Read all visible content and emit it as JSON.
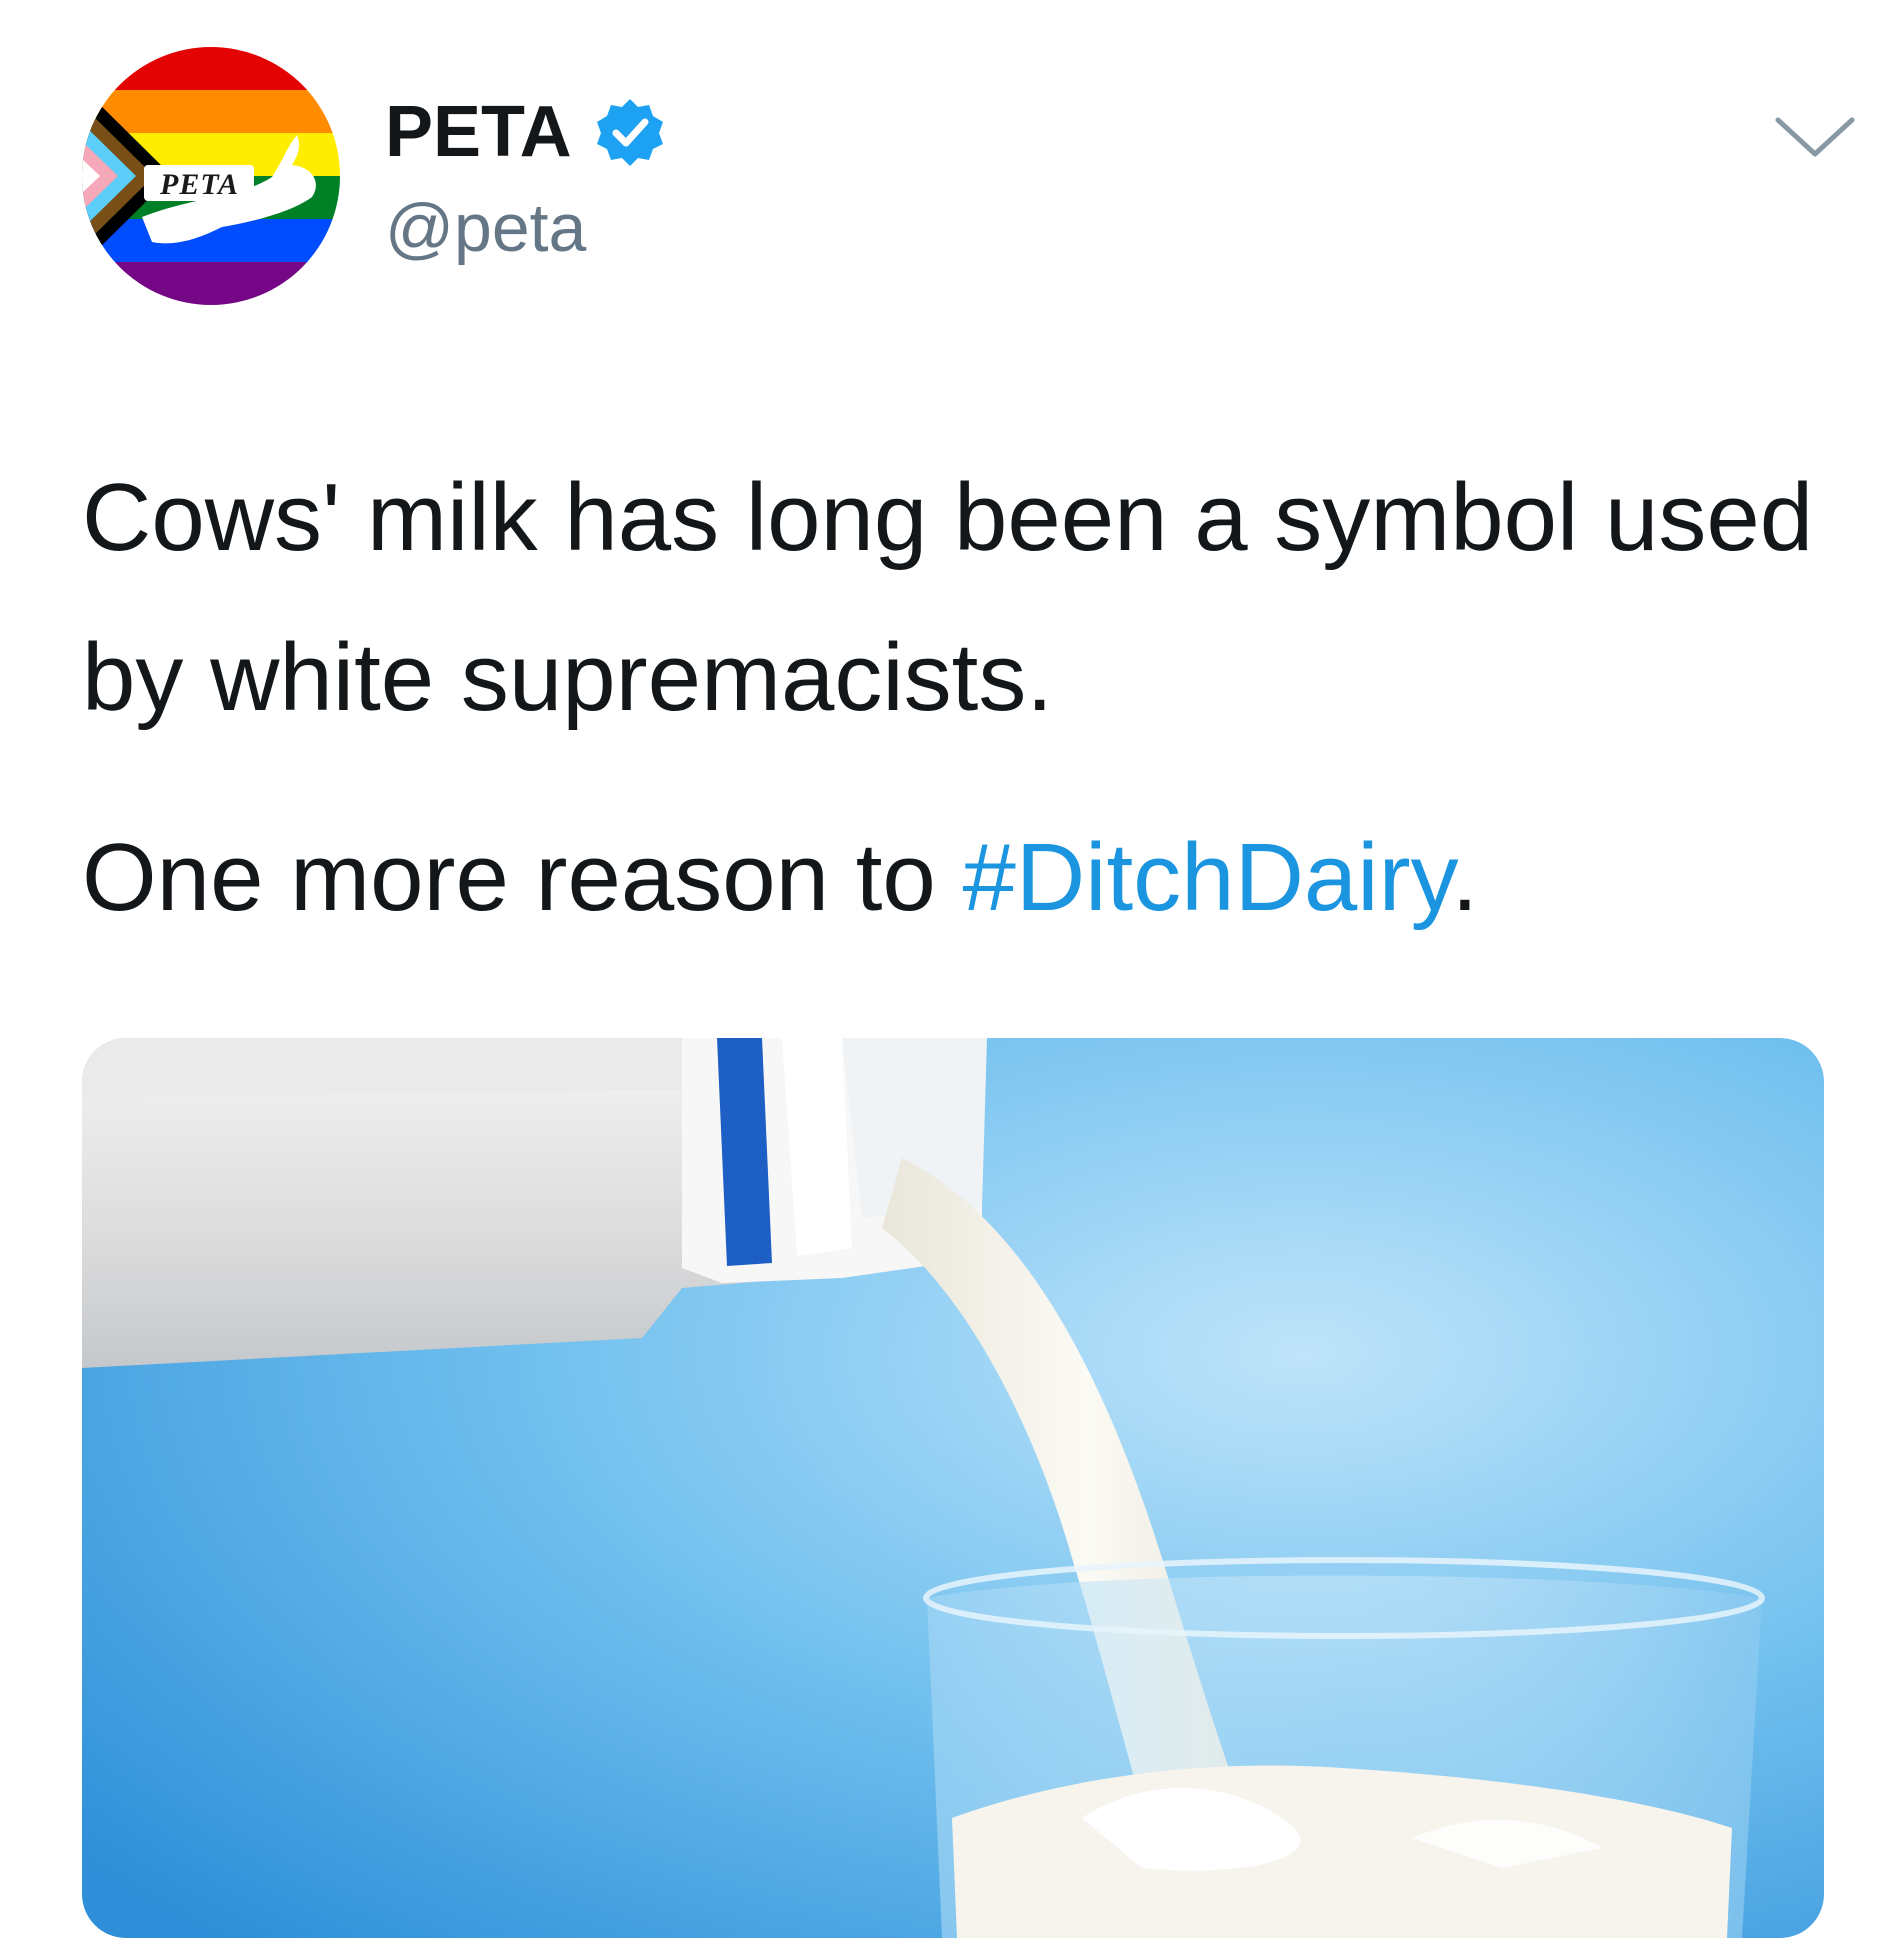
{
  "tweet": {
    "display_name": "PETA",
    "handle": "@peta",
    "avatar_logo_text": "PETA",
    "verified_icon": "verified-badge-icon",
    "menu_icon": "chevron-down-icon",
    "text_line1": "Cows' milk has long been a symbol used by white supremacists.",
    "text_line2_prefix": "One more reason to ",
    "hashtag": "#DitchDairy",
    "text_line2_suffix": ".",
    "media_description_icon": "milk-pouring-photo"
  },
  "colors": {
    "hashtag": "#1b95e0",
    "verified": "#1da1f2",
    "handle": "#657786",
    "text": "#14171a"
  }
}
